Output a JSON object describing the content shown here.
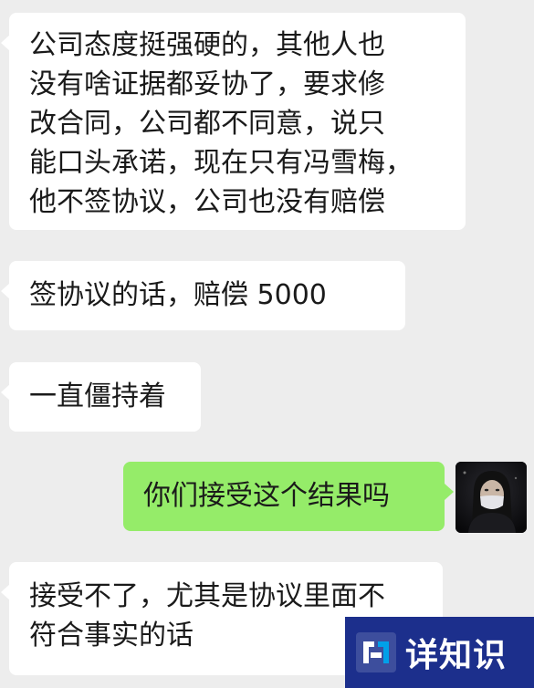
{
  "messages": [
    {
      "side": "in",
      "lines": [
        "公司态度挺强硬的，其他人也",
        "没有啥证据都妥协了，要求修",
        "改合同，公司都不同意，说只",
        "能口头承诺，现在只有冯雪梅，",
        "他不签协议，公司也没有赔偿"
      ]
    },
    {
      "side": "in",
      "lines": [
        "签协议的话，赔偿 5000"
      ]
    },
    {
      "side": "in",
      "lines": [
        "一直僵持着"
      ]
    },
    {
      "side": "out",
      "lines": [
        "你们接受这个结果吗"
      ]
    },
    {
      "side": "in",
      "lines": [
        "接受不了，尤其是协议里面不",
        "符合事实的话"
      ]
    }
  ],
  "watermark": {
    "text": "详知识"
  },
  "colors": {
    "background": "#ededed",
    "incoming_bubble": "#ffffff",
    "outgoing_bubble": "#95ec69",
    "watermark_bg": "#1c2f8c"
  }
}
